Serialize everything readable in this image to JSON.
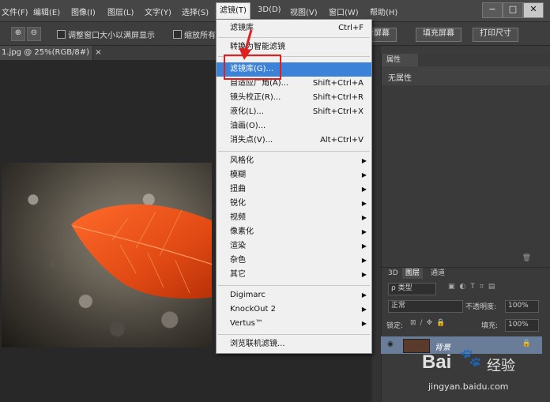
{
  "menubar": {
    "items": [
      "文件(F)",
      "编辑(E)",
      "图像(I)",
      "图层(L)",
      "文字(Y)",
      "选择(S)",
      "滤镜(T)",
      "3D(D)",
      "视图(V)",
      "窗口(W)",
      "帮助(H)"
    ],
    "window_controls": [
      "−",
      "□",
      "✕"
    ]
  },
  "options": {
    "resize_label": "调整窗口大小以满屏显示",
    "zoom_all_label": "缩放所有",
    "btn_fit": "适合屏幕",
    "btn_fill": "填充屏幕",
    "btn_print": "打印尺寸"
  },
  "document": {
    "tab_title": "1.jpg @ 25%(RGB/8#)",
    "close": "×"
  },
  "filter_menu": {
    "last_filter": {
      "label": "滤镜库",
      "shortcut": "Ctrl+F"
    },
    "smart": "转换为智能滤镜",
    "gallery": "滤镜库(G)...",
    "adaptive_wide": {
      "label": "自适应广角(A)...",
      "shortcut": "Shift+Ctrl+A"
    },
    "lens": {
      "label": "镜头校正(R)...",
      "shortcut": "Shift+Ctrl+R"
    },
    "liquify": {
      "label": "液化(L)...",
      "shortcut": "Shift+Ctrl+X"
    },
    "oil": "油画(O)...",
    "vanishing": {
      "label": "消失点(V)...",
      "shortcut": "Alt+Ctrl+V"
    },
    "submenus": [
      "风格化",
      "模糊",
      "扭曲",
      "锐化",
      "视频",
      "像素化",
      "渲染",
      "杂色",
      "其它"
    ],
    "plugins": [
      "Digimarc",
      "KnockOut 2",
      "Vertus™"
    ],
    "browse": "浏览联机滤镜..."
  },
  "properties": {
    "tab": "属性",
    "empty": "无属性"
  },
  "layers": {
    "tabs": [
      "3D",
      "图层",
      "通道"
    ],
    "filter_kind": "ρ 类型",
    "blend_mode": "正常",
    "opacity_label": "不透明度:",
    "opacity_value": "100%",
    "lock_label": "锁定:",
    "fill_label": "填充:",
    "fill_value": "100%",
    "layer_name": "背景"
  },
  "watermark": {
    "brand": "Bai",
    "brand2": "经验",
    "url": "jingyan.baidu.com"
  },
  "colors": {
    "highlight": "#3c82d8",
    "annotation": "#e02020"
  }
}
